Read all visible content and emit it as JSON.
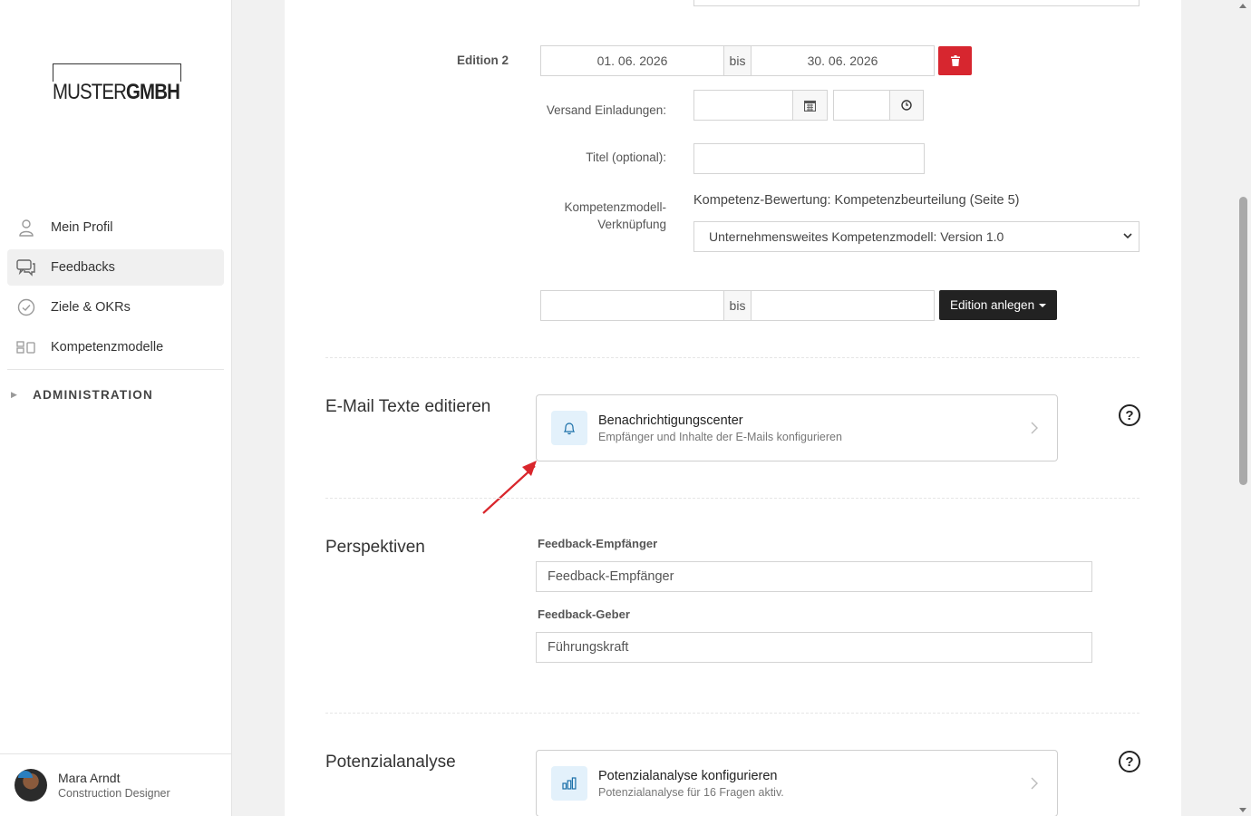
{
  "brand": {
    "logo_regular": "MUSTER",
    "logo_bold": "GMBH"
  },
  "nav": {
    "items": [
      {
        "label": "Mein Profil",
        "icon": "user-icon",
        "active": false
      },
      {
        "label": "Feedbacks",
        "icon": "chat-icon",
        "active": true
      },
      {
        "label": "Ziele & OKRs",
        "icon": "check-circle-icon",
        "active": false
      },
      {
        "label": "Kompetenzmodelle",
        "icon": "grid-icon",
        "active": false
      }
    ],
    "admin_label": "ADMINISTRATION"
  },
  "user": {
    "name": "Mara Arndt",
    "role": "Construction Designer"
  },
  "edition": {
    "label": "Edition 2",
    "start": "01. 06. 2026",
    "bis": "bis",
    "end": "30. 06. 2026",
    "versand_label": "Versand Einladungen:",
    "titel_label": "Titel (optional):",
    "kompetenz_label": "Kompetenzmodell-Verknüpfung",
    "kompetenz_text": "Kompetenz-Bewertung: Kompetenzbeurteilung (Seite 5)",
    "kompetenz_select": "Unternehmensweites Kompetenzmodell: Version 1.0"
  },
  "new_edition": {
    "bis": "bis",
    "button_label": "Edition anlegen"
  },
  "email_section": {
    "title": "E-Mail Texte editieren",
    "card_title": "Benachrichtigungscenter",
    "card_subtitle": "Empfänger und Inhalte der E-Mails konfigurieren"
  },
  "perspektiven": {
    "title": "Perspektiven",
    "empfaenger_label": "Feedback-Empfänger",
    "empfaenger_value": "Feedback-Empfänger",
    "geber_label": "Feedback-Geber",
    "geber_value": "Führungskraft"
  },
  "potenzial": {
    "title": "Potenzialanalyse",
    "card_title": "Potenzialanalyse konfigurieren",
    "card_subtitle": "Potenzialanalyse für 16 Fragen aktiv."
  },
  "colors": {
    "danger": "#d7262f",
    "annotation_arrow": "#d9262c",
    "icon_bg": "#e3f1fb"
  }
}
